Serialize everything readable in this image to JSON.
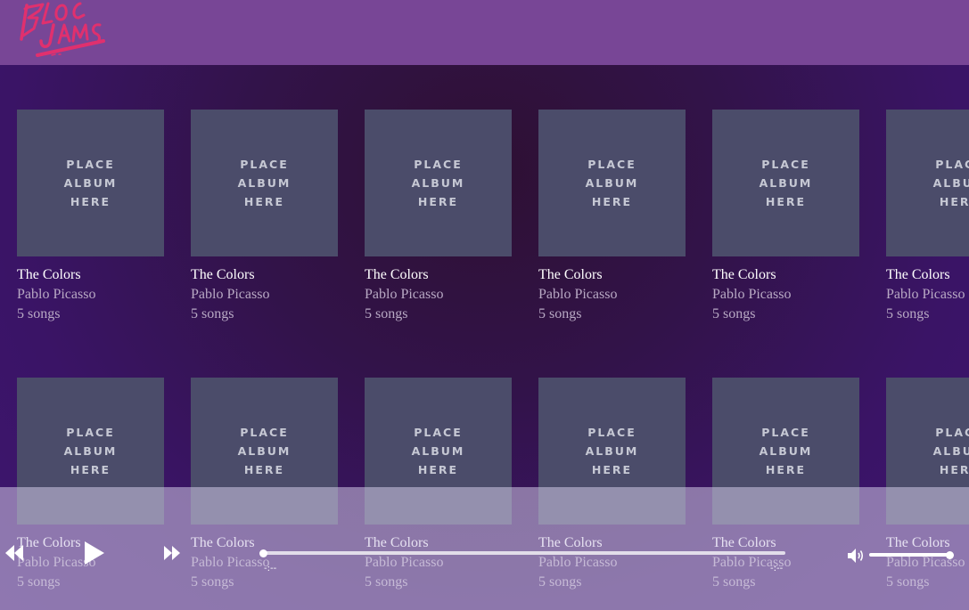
{
  "navbar": {
    "logo_text": "Bloc Jams",
    "logo_color": "#e0306e",
    "background": "#784696"
  },
  "collection": {
    "albums": [
      {
        "cover_text": "PLACE ALBUM HERE",
        "title": "The Colors",
        "artist": "Pablo Picasso",
        "song_count": "5 songs"
      },
      {
        "cover_text": "PLACE ALBUM HERE",
        "title": "The Colors",
        "artist": "Pablo Picasso",
        "song_count": "5 songs"
      },
      {
        "cover_text": "PLACE ALBUM HERE",
        "title": "The Colors",
        "artist": "Pablo Picasso",
        "song_count": "5 songs"
      },
      {
        "cover_text": "PLACE ALBUM HERE",
        "title": "The Colors",
        "artist": "Pablo Picasso",
        "song_count": "5 songs"
      },
      {
        "cover_text": "PLACE ALBUM HERE",
        "title": "The Colors",
        "artist": "Pablo Picasso",
        "song_count": "5 songs"
      },
      {
        "cover_text": "PLACE ALBUM HERE",
        "title": "The Colors",
        "artist": "Pablo Picasso",
        "song_count": "5 songs"
      },
      {
        "cover_text": "PLACE ALBUM HERE",
        "title": "The Colors",
        "artist": "Pablo Picasso",
        "song_count": "5 songs"
      },
      {
        "cover_text": "PLACE ALBUM HERE",
        "title": "The Colors",
        "artist": "Pablo Picasso",
        "song_count": "5 songs"
      },
      {
        "cover_text": "PLACE ALBUM HERE",
        "title": "The Colors",
        "artist": "Pablo Picasso",
        "song_count": "5 songs"
      },
      {
        "cover_text": "PLACE ALBUM HERE",
        "title": "The Colors",
        "artist": "Pablo Picasso",
        "song_count": "5 songs"
      },
      {
        "cover_text": "PLACE ALBUM HERE",
        "title": "The Colors",
        "artist": "Pablo Picasso",
        "song_count": "5 songs"
      },
      {
        "cover_text": "PLACE ALBUM HERE",
        "title": "The Colors",
        "artist": "Pablo Picasso",
        "song_count": "5 songs"
      }
    ]
  },
  "player": {
    "previous_icon": "previous-icon",
    "play_icon": "play-icon",
    "next_icon": "next-icon",
    "volume_icon": "volume-icon",
    "current_time": "-:--",
    "total_time": "-:--",
    "seek_fraction": 0.0,
    "volume_fraction": 1.0
  }
}
